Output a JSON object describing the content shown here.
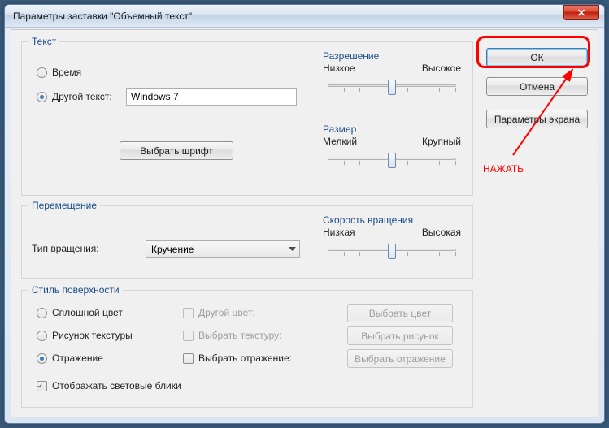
{
  "window": {
    "title": "Параметры заставки \"Объемный текст\""
  },
  "buttons": {
    "ok": "ОК",
    "cancel": "Отмена",
    "display_params": "Параметры экрана",
    "choose_font": "Выбрать шрифт",
    "choose_color": "Выбрать цвет",
    "choose_image": "Выбрать рисунок",
    "choose_reflection": "Выбрать отражение"
  },
  "groups": {
    "text": "Текст",
    "motion": "Перемещение",
    "surface": "Стиль поверхности"
  },
  "text_section": {
    "time": "Время",
    "custom": "Другой текст:",
    "custom_value": "Windows 7"
  },
  "sliders": {
    "resolution": {
      "title": "Разрешение",
      "low": "Низкое",
      "high": "Высокое"
    },
    "size": {
      "title": "Размер",
      "low": "Мелкий",
      "high": "Крупный"
    },
    "speed": {
      "title": "Скорость вращения",
      "low": "Низкая",
      "high": "Высокая"
    }
  },
  "motion": {
    "type_label": "Тип вращения:",
    "selected": "Кручение"
  },
  "surface": {
    "solid": "Сплошной цвет",
    "texture": "Рисунок текстуры",
    "reflection": "Отражение",
    "custom_color": "Другой цвет:",
    "custom_texture": "Выбрать текстуру:",
    "custom_reflection": "Выбрать отражение:",
    "highlights": "Отображать световые блики"
  },
  "annotation": {
    "label": "НАЖАТЬ"
  }
}
